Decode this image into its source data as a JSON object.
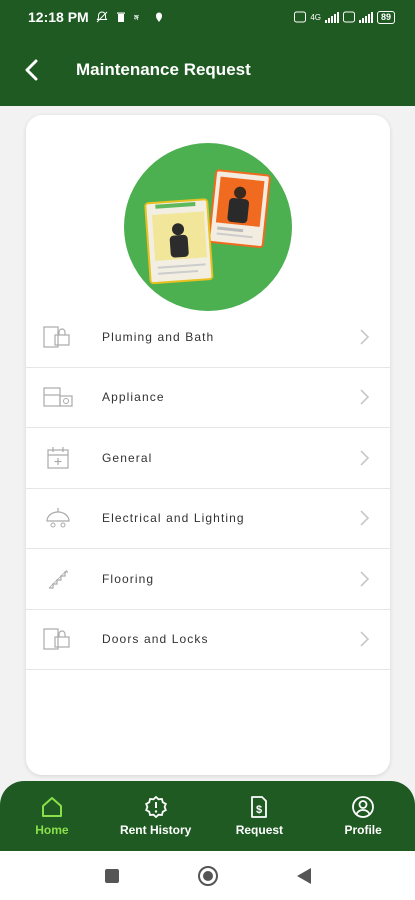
{
  "status_bar": {
    "time": "12:18 PM",
    "network_label": "4G",
    "battery": "89"
  },
  "app_bar": {
    "title": "Maintenance Request",
    "back_icon": "chevron-left-icon"
  },
  "categories": [
    {
      "label": "Pluming and Bath",
      "icon": "door-lock-icon"
    },
    {
      "label": "Appliance",
      "icon": "appliance-icon"
    },
    {
      "label": "General",
      "icon": "calendar-plus-icon"
    },
    {
      "label": "Electrical and Lighting",
      "icon": "ceiling-light-icon"
    },
    {
      "label": "Flooring",
      "icon": "stairs-icon"
    },
    {
      "label": "Doors and Locks",
      "icon": "door-lock-icon"
    }
  ],
  "bottom_nav": [
    {
      "label": "Home",
      "icon": "home-icon",
      "active": true
    },
    {
      "label": "Rent History",
      "icon": "alert-circle-icon",
      "active": false
    },
    {
      "label": "Request",
      "icon": "dollar-document-icon",
      "active": false
    },
    {
      "label": "Profile",
      "icon": "user-circle-icon",
      "active": false
    }
  ],
  "colors": {
    "primary": "#1f5a23",
    "active_nav": "#8ae04a",
    "hero_circle": "#4caf50",
    "hero_accent": "#f06a1f"
  }
}
